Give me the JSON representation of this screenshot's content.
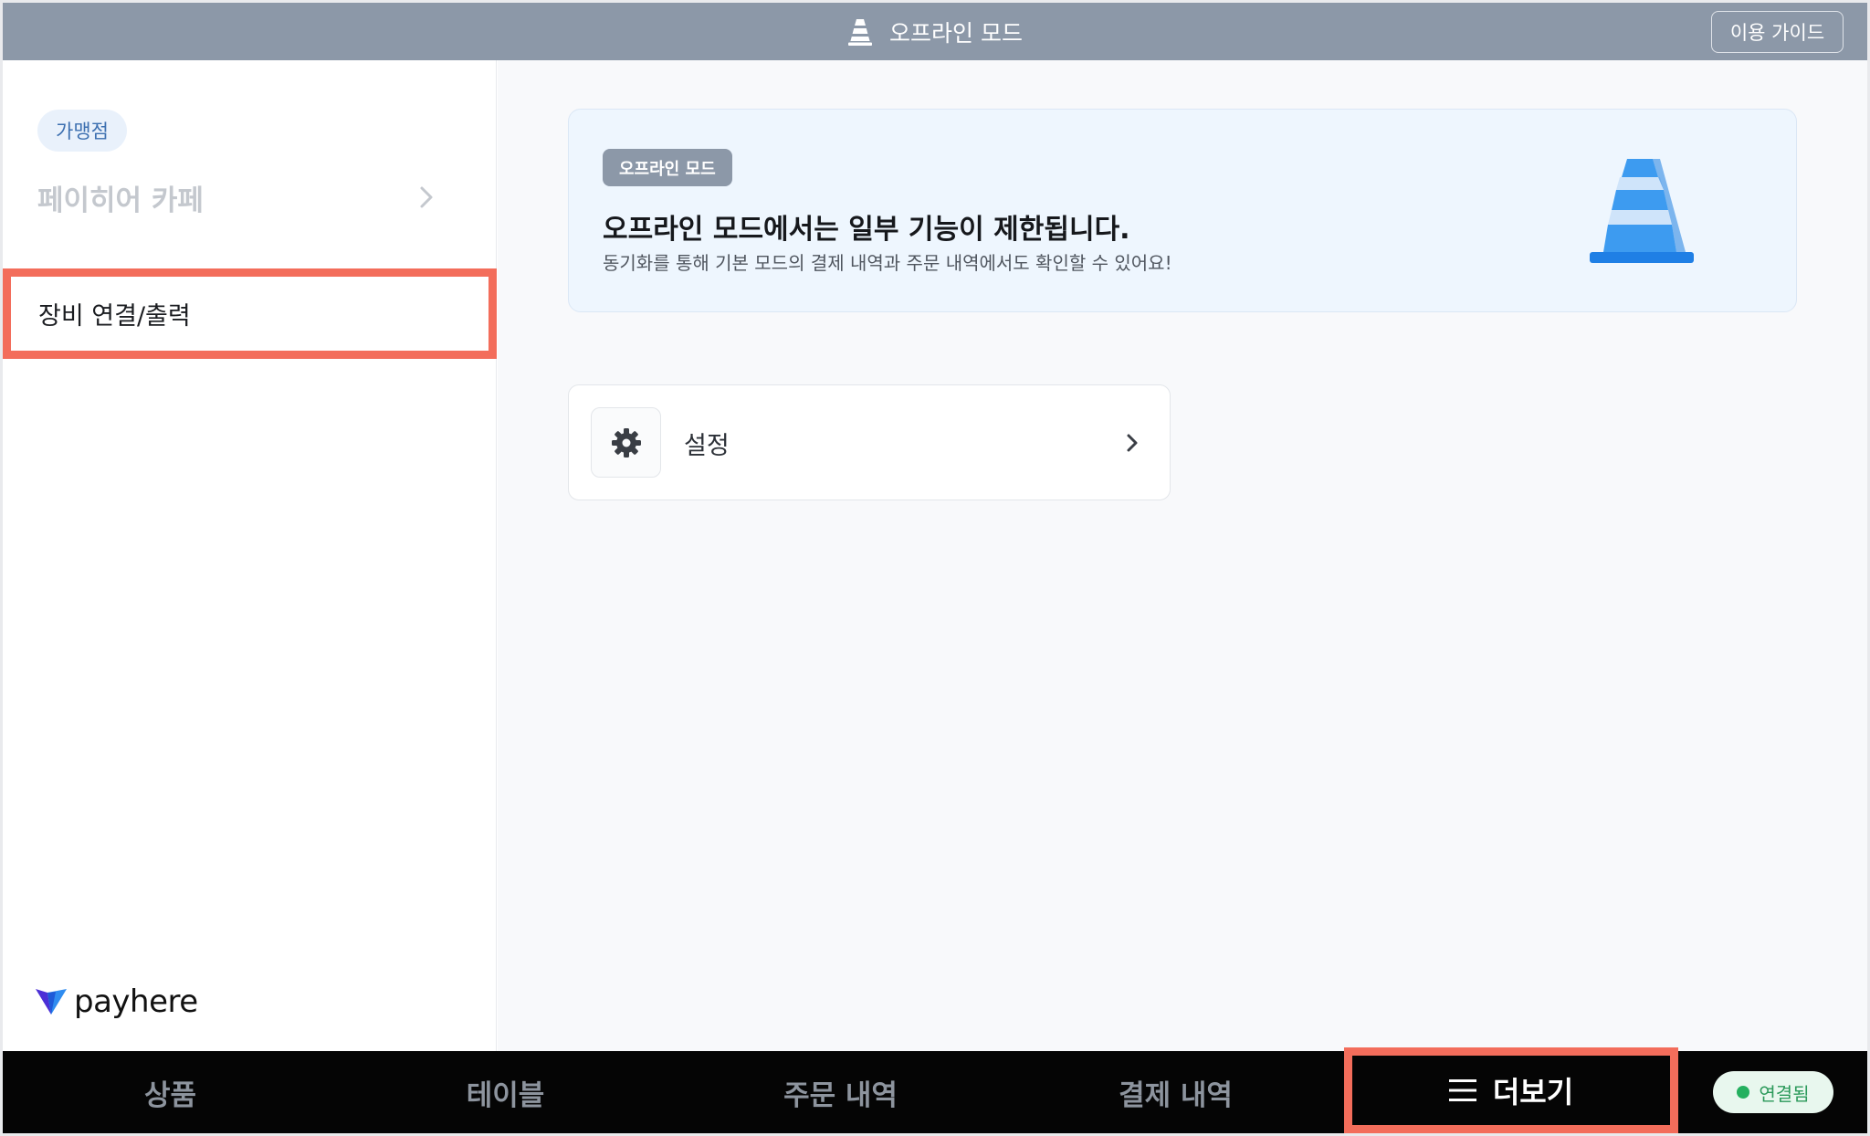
{
  "header": {
    "title": "오프라인 모드",
    "guide_button": "이용 가이드"
  },
  "sidebar": {
    "store_badge": "가맹점",
    "store_name": "페이히어 카페",
    "menu_items": [
      {
        "label": "장비 연결/출력"
      }
    ],
    "logo_text": "payhere"
  },
  "main": {
    "banner": {
      "tag": "오프라인 모드",
      "title": "오프라인 모드에서는 일부 기능이 제한됩니다.",
      "description": "동기화를 통해 기본 모드의 결제 내역과 주문 내역에서도 확인할 수 있어요!"
    },
    "settings_card": {
      "label": "설정"
    }
  },
  "bottom_nav": {
    "items": [
      {
        "label": "상품"
      },
      {
        "label": "테이블"
      },
      {
        "label": "주문 내역"
      },
      {
        "label": "결제 내역"
      }
    ],
    "more": "더보기",
    "status": "연결됨"
  },
  "colors": {
    "top_bar": "#8c98a8",
    "highlight": "#f36d5b",
    "banner_bg": "#eef6fe",
    "cone_blue": "#3d9bf0",
    "status_green": "#24b05f"
  },
  "icons": {
    "header": "traffic-cone-icon",
    "store_chevron": "chevron-right-icon",
    "logo": "payhere-logo-icon",
    "banner": "traffic-cone-icon",
    "settings": "gear-icon",
    "settings_chevron": "chevron-right-icon",
    "more": "hamburger-menu-icon",
    "status": "status-dot-icon"
  }
}
